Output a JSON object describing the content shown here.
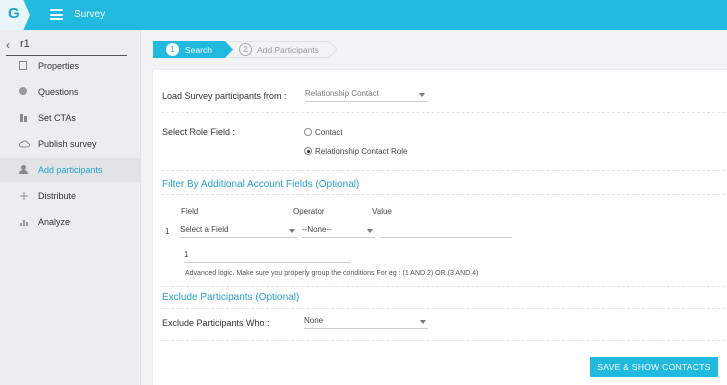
{
  "app": {
    "logo_letter": "G",
    "title": "Survey"
  },
  "sidebar": {
    "survey_name": "r1",
    "items": [
      {
        "label": "Properties",
        "icon": "document-icon",
        "active": false
      },
      {
        "label": "Questions",
        "icon": "question-icon",
        "active": false
      },
      {
        "label": "Set CTAs",
        "icon": "cta-icon",
        "active": false
      },
      {
        "label": "Publish survey",
        "icon": "cloud-icon",
        "active": false
      },
      {
        "label": "Add participants",
        "icon": "user-icon",
        "active": true
      },
      {
        "label": "Distribute",
        "icon": "distribute-icon",
        "active": false
      },
      {
        "label": "Analyze",
        "icon": "bar-chart-icon",
        "active": false
      }
    ]
  },
  "steps": [
    {
      "number": "1",
      "label": "Search",
      "active": true
    },
    {
      "number": "2",
      "label": "Add Participants",
      "active": false
    }
  ],
  "form": {
    "load_label": "Load Survey participants from :",
    "load_value": "Relationship Contact",
    "role_label": "Select Role Field :",
    "role_options": [
      {
        "label": "Contact",
        "checked": false
      },
      {
        "label": "Relationship Contact Role",
        "checked": true
      }
    ],
    "filter_title": "Filter By Additional Account Fields (Optional)",
    "columns": {
      "field": "Field",
      "operator": "Operator",
      "value": "Value"
    },
    "row_number": "1",
    "field_value": "Select a Field",
    "operator_value": "--None--",
    "value_value": "",
    "advanced_logic_value": "1",
    "advanced_logic_hint": "Advanced logic. Make sure you properly group the conditions For eg : (1 AND 2) OR (3 AND 4)",
    "exclude_title": "Exclude Participants (Optional)",
    "exclude_label": "Exclude Participants Who :",
    "exclude_value": "None",
    "submit_label": "SAVE & SHOW CONTACTS"
  },
  "colors": {
    "accent": "#22b9de",
    "link": "#2a9fc9",
    "sidebar_bg": "#ecedef"
  }
}
